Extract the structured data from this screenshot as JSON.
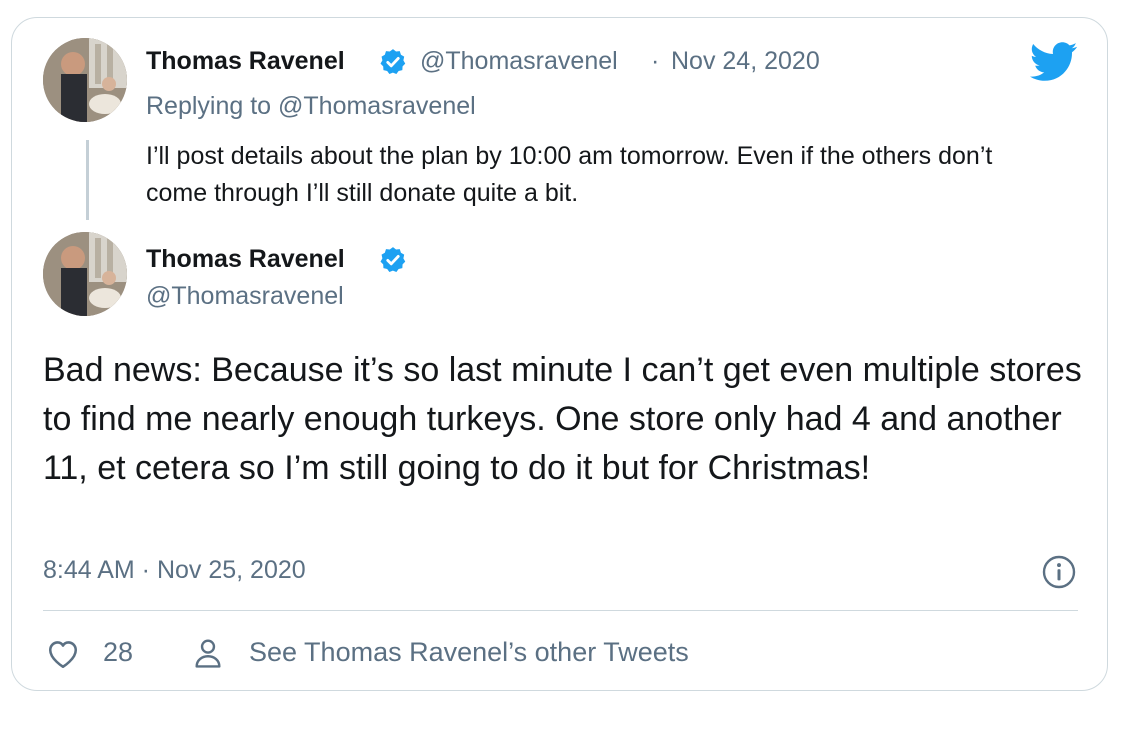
{
  "reply_tweet": {
    "author_name": "Thomas Ravenel",
    "handle": "@Thomasravenel",
    "separator": "·",
    "date": "Nov 24, 2020",
    "replying_to": "Replying to @Thomasravenel",
    "text": "I’ll post details about the plan by 10:00 am tomorrow. Even if the others don’t come through I’ll still donate quite a bit."
  },
  "main_tweet": {
    "author_name": "Thomas Ravenel",
    "handle": "@Thomasravenel",
    "text": "Bad news: Because it’s so last minute I can’t get even multiple stores to find me nearly enough turkeys.  One store only had 4 and another 11, et cetera so I’m still going to do it but for Christmas!",
    "timestamp": "8:44 AM · Nov 25, 2020"
  },
  "actions": {
    "like_count": "28",
    "profile_link": "See Thomas Ravenel’s other Tweets"
  },
  "icons": {
    "logo": "twitter-bird-icon",
    "verified": "verified-badge-icon",
    "info": "info-icon",
    "like": "heart-icon",
    "profile": "person-icon"
  },
  "colors": {
    "brand_blue": "#1da1f2",
    "muted_text": "#5b7083",
    "border": "#cfd9de"
  }
}
